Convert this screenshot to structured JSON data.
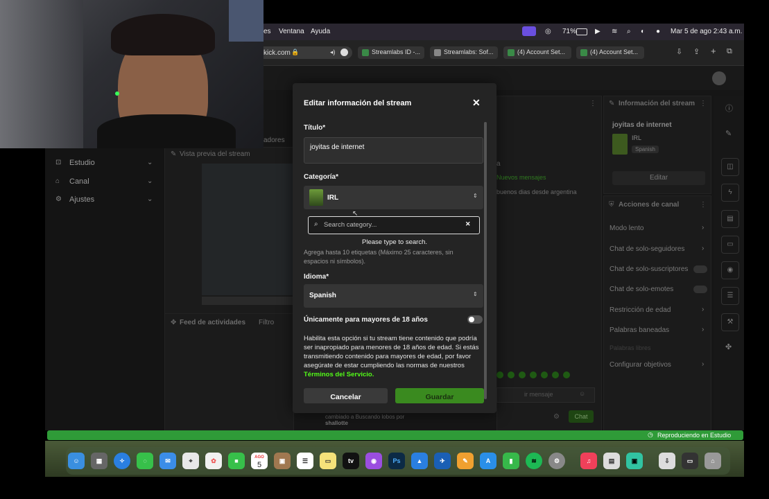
{
  "menubar": {
    "items": [
      "es",
      "Ventana",
      "Ayuda"
    ],
    "battery": "71%",
    "datetime": "Mar 5 de ago  2:43 a.m."
  },
  "browser": {
    "url": "kick.com",
    "tabs": [
      "Streamlabs ID -...",
      "Streamlabs: Sof...",
      "(4) Account Set...",
      "(4) Account Set..."
    ]
  },
  "left_nav": {
    "partial_label": "adores",
    "items": [
      {
        "label": "Estudio",
        "icon": "studio-icon"
      },
      {
        "label": "Canal",
        "icon": "channel-icon"
      },
      {
        "label": "Ajustes",
        "icon": "settings-icon"
      }
    ]
  },
  "preview": {
    "title": "Vista previa del stream"
  },
  "activity": {
    "title": "Feed de actividades",
    "filter": "Filtro"
  },
  "chat": {
    "partial_top": "a",
    "new_messages": "Nuevos mensajes",
    "message": "buenos dias desde argentina",
    "input_placeholder": "ir mensaje",
    "send_label": "Chat",
    "activity_item": "cambiado a Buscando lobos por",
    "activity_user": "shallotte"
  },
  "stream_info": {
    "title": "Información del stream",
    "stream_title": "joyitas de internet",
    "category": "IRL",
    "language": "Spanish",
    "edit_label": "Editar"
  },
  "channel_actions": {
    "title": "Acciones de canal",
    "items": [
      "Modo lento",
      "Chat de solo-seguidores",
      "Chat de solo-suscriptores",
      "Chat de solo-emotes",
      "Restricción de edad",
      "Palabras baneadas",
      "Palabras libres",
      "Configurar objetivos"
    ]
  },
  "modal": {
    "heading": "Editar información del stream",
    "title_label": "Título*",
    "title_value": "joyitas de internet",
    "category_label": "Categoría*",
    "category_value": "IRL",
    "search_placeholder": "Search category...",
    "search_hint": "Please type to search.",
    "tags_hint": "Agrega hasta 10 etiquetas (Máximo 25 caracteres, sin espacios ni símbolos).",
    "language_label": "Idioma*",
    "language_value": "Spanish",
    "adult_label": "Únicamente para mayores de 18 años",
    "adult_help": "Habilita esta opción si tu stream tiene contenido que podría ser inapropiado para menores de 18 años de edad. Si estás transmitiendo contenido para mayores de edad, por favor asegúrate de estar cumpliendo las normas de nuestros",
    "terms_link": "Términos del Servicio.",
    "cancel_label": "Cancelar",
    "save_label": "Guardar"
  },
  "status": {
    "text": "Reproduciendo en Estudio"
  },
  "dock": {
    "calendar_month": "AGO",
    "calendar_day": "5",
    "apps": [
      "finder-icon",
      "launchpad-icon",
      "safari-icon",
      "messages-icon",
      "mail-icon",
      "maps-icon",
      "photos-icon",
      "facetime-icon",
      "calendar-icon",
      "notes-brown-icon",
      "reminders-icon",
      "notes-icon",
      "tv-icon",
      "podcasts-icon",
      "photoshop-icon",
      "keynote-icon",
      "testflight-icon",
      "pages-icon",
      "appstore-icon",
      "numbers-icon",
      "spotify-icon",
      "settings-icon",
      "music-icon",
      "preview-icon",
      "streamlabs-icon",
      "downloads-icon",
      "desktop-icon",
      "trash-icon"
    ]
  },
  "colors": {
    "accent": "#53fc18",
    "status_green": "#2f9b38",
    "modal_bg": "#242424"
  }
}
